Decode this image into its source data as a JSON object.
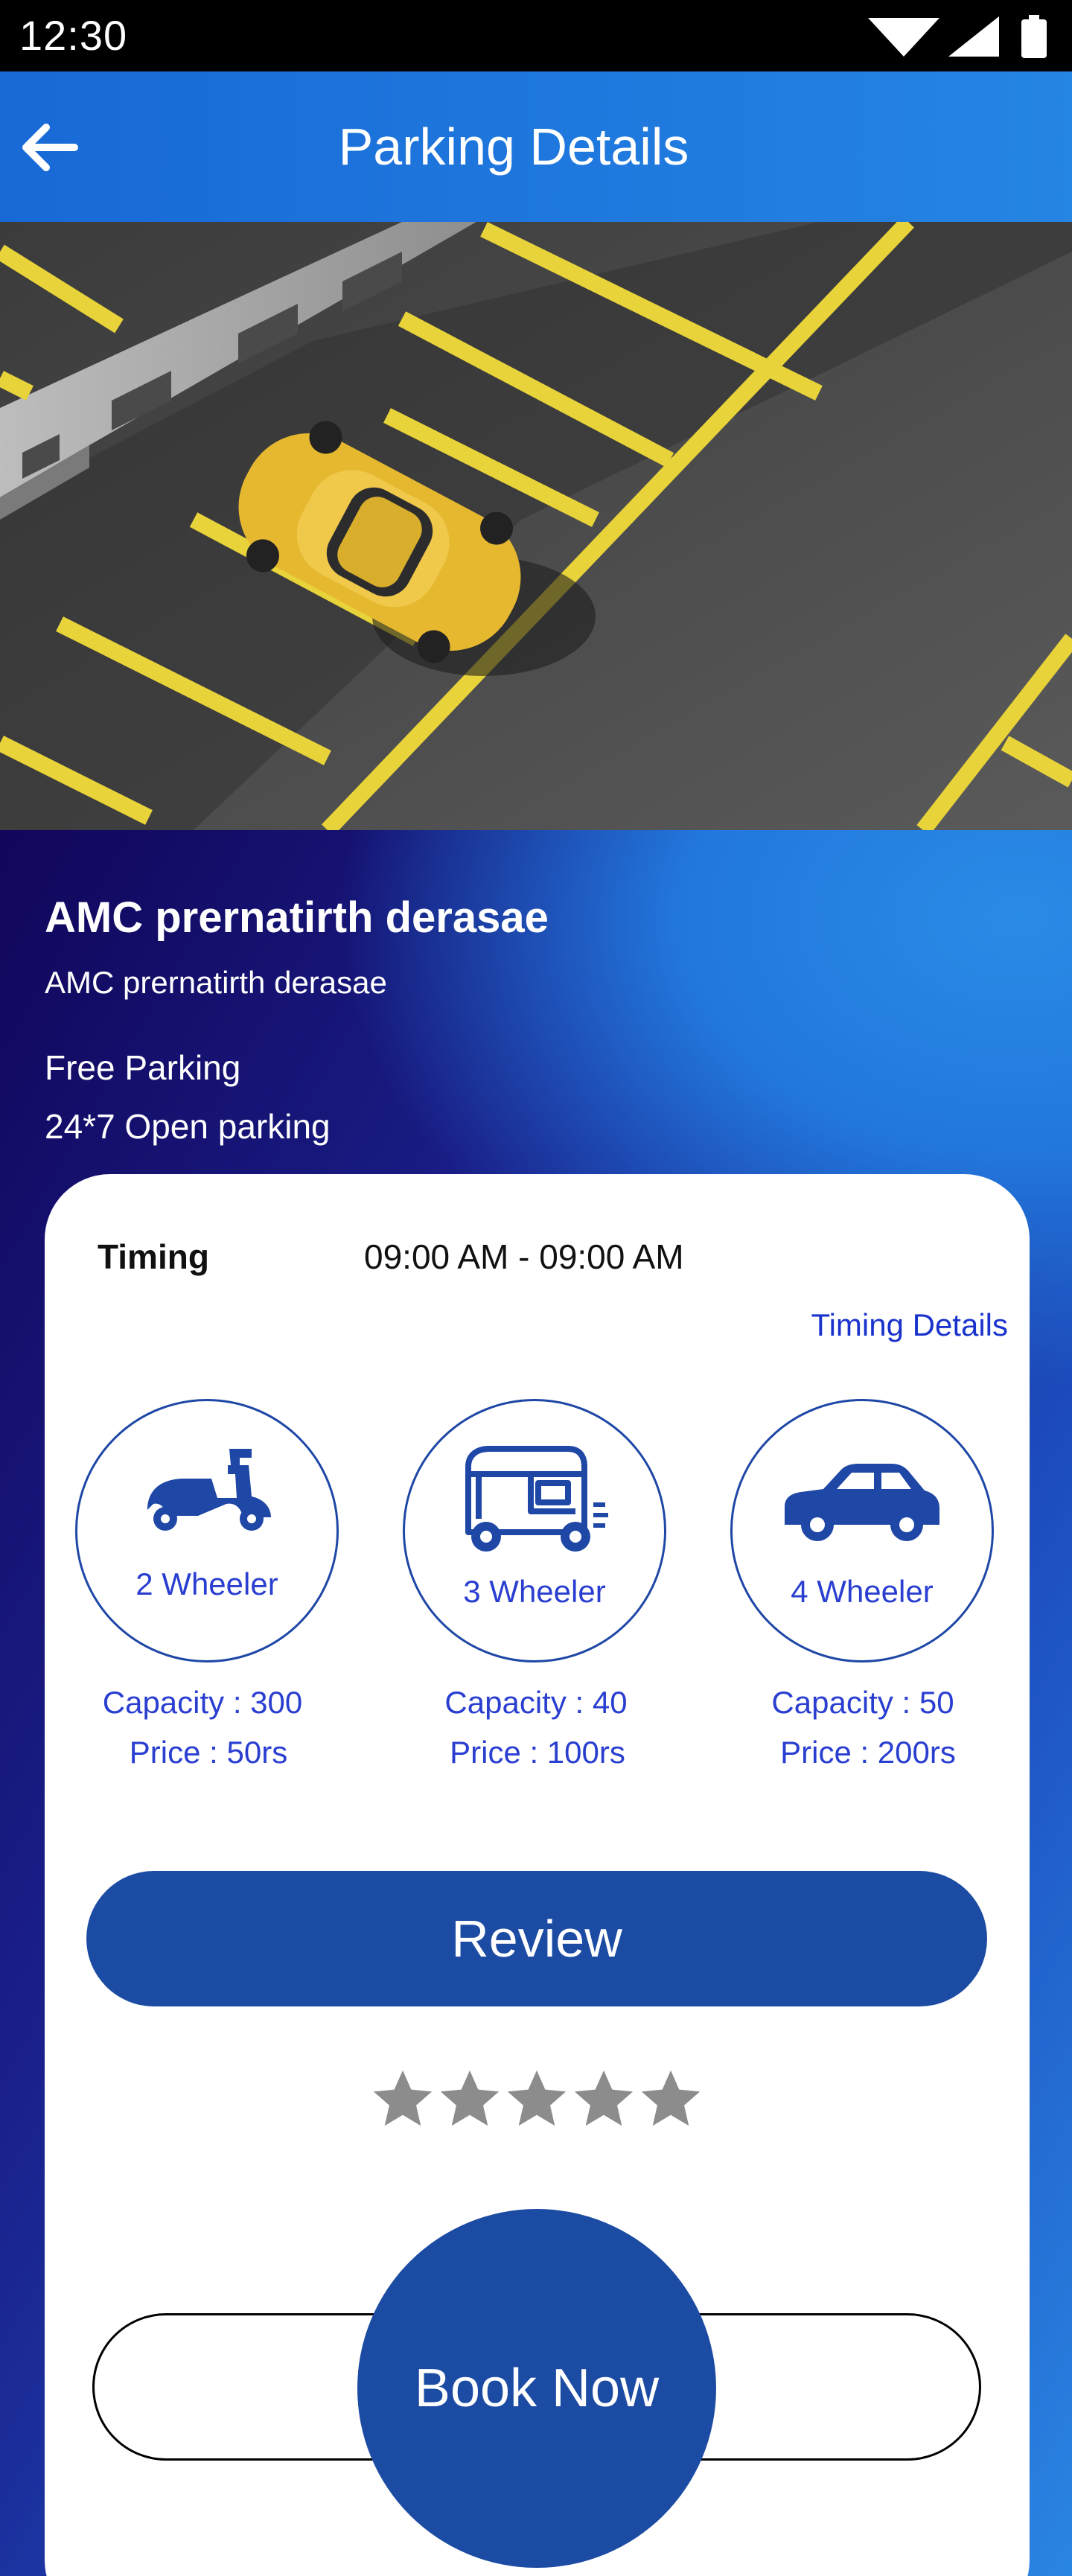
{
  "status_bar": {
    "time": "12:30"
  },
  "app_bar": {
    "title": "Parking Details",
    "back_icon": "arrow-left-icon"
  },
  "hero": {
    "description_icon": "parking-lot-photo"
  },
  "place": {
    "name": "AMC prernatirth derasae",
    "address": "AMC prernatirth derasae",
    "parking_type": "Free Parking",
    "open_hours": "24*7 Open parking"
  },
  "timing": {
    "label": "Timing",
    "value": "09:00 AM - 09:00 AM",
    "details_link": "Timing Details"
  },
  "vehicles": [
    {
      "label": "2 Wheeler",
      "icon": "scooter-icon",
      "capacity": "Capacity : 300",
      "price": "Price : 50rs"
    },
    {
      "label": "3 Wheeler",
      "icon": "auto-rickshaw-icon",
      "capacity": "Capacity : 40",
      "price": "Price : 100rs"
    },
    {
      "label": "4 Wheeler",
      "icon": "car-icon",
      "capacity": "Capacity : 50",
      "price": "Price : 200rs"
    }
  ],
  "review": {
    "button_label": "Review",
    "rating": 0,
    "max_rating": 5
  },
  "book": {
    "button_label": "Book Now"
  },
  "colors": {
    "app_bar": "#1d74dc",
    "primary_button": "#1c4ba3",
    "vehicle_text": "#2a3fd0",
    "star_inactive": "#8c8c8c"
  }
}
